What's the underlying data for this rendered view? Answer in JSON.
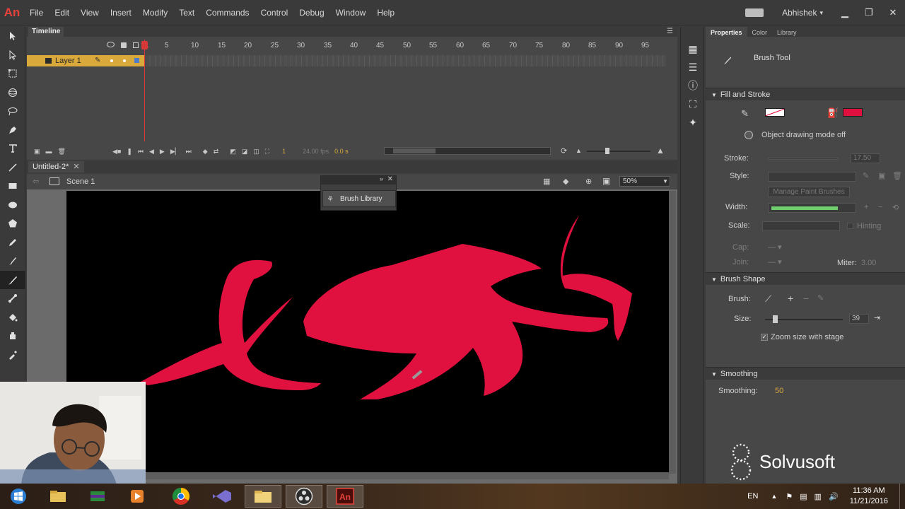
{
  "app": {
    "logo": "An"
  },
  "menu": [
    "File",
    "Edit",
    "View",
    "Insert",
    "Modify",
    "Text",
    "Commands",
    "Control",
    "Debug",
    "Window",
    "Help"
  ],
  "user": {
    "name": "Abhishek",
    "caret": "▾"
  },
  "window_controls": {
    "minimize": "▁",
    "restore": "❐",
    "close": "✕"
  },
  "tools": [
    "selection-tool-icon",
    "subselection-tool-icon",
    "free-transform-tool-icon",
    "3d-rotation-tool-icon",
    "lasso-tool-icon",
    "pen-tool-icon",
    "text-tool-icon",
    "line-tool-icon",
    "rectangle-tool-icon",
    "oval-tool-icon",
    "polystar-tool-icon",
    "pencil-tool-icon",
    "paint-brush-tool-icon",
    "brush-tool-icon",
    "bone-tool-icon",
    "paint-bucket-tool-icon",
    "ink-bottle-tool-icon",
    "eyedropper-tool-icon"
  ],
  "timeline": {
    "title": "Timeline",
    "menu_glyph": "☰",
    "frame_numbers": [
      "1",
      "5",
      "10",
      "15",
      "20",
      "25",
      "30",
      "35",
      "40",
      "45",
      "50",
      "55",
      "60",
      "65",
      "70",
      "75",
      "80",
      "85",
      "90",
      "95"
    ],
    "layer_name": "Layer 1",
    "current_frame": "1",
    "fps": "24.00 fps",
    "elapsed": "0.0 s"
  },
  "document": {
    "tab_title": "Untitled-2*",
    "close_glyph": "✕",
    "scene": "Scene 1",
    "zoom": "50%"
  },
  "brush_panel": {
    "expand_glyph": "»",
    "close_glyph": "✕",
    "button_label": "Brush Library"
  },
  "properties": {
    "tabs": [
      "Properties",
      "Color",
      "Library"
    ],
    "tool_name": "Brush Tool",
    "sections": {
      "fill_stroke": "Fill and Stroke",
      "brush_shape": "Brush Shape",
      "smoothing": "Smoothing"
    },
    "object_drawing": "Object drawing mode off",
    "stroke_label": "Stroke:",
    "stroke_value": "17.50",
    "style_label": "Style:",
    "manage_brushes": "Manage Paint Brushes",
    "width_label": "Width:",
    "scale_label": "Scale:",
    "hinting": "Hinting",
    "cap_label": "Cap:",
    "join_label": "Join:",
    "miter_label": "Miter:",
    "miter_value": "3.00",
    "brush_label": "Brush:",
    "size_label": "Size:",
    "size_value": "39",
    "size_fraction": 0.1,
    "zoom_size": "Zoom size with stage",
    "smoothing_label": "Smoothing:",
    "smoothing_value": "50",
    "colors": {
      "fill": "#e0103f",
      "accent": "#d9a93b",
      "stage": "#000000"
    }
  },
  "watermark": "Solvusoft",
  "taskbar": {
    "apps": [
      "windows-start-icon",
      "file-explorer-icon",
      "app-icon",
      "media-player-icon",
      "chrome-icon",
      "visual-studio-icon",
      "folder-icon",
      "obs-icon",
      "animate-icon"
    ],
    "language": "EN",
    "time": "11:36 AM",
    "date": "11/21/2016"
  }
}
